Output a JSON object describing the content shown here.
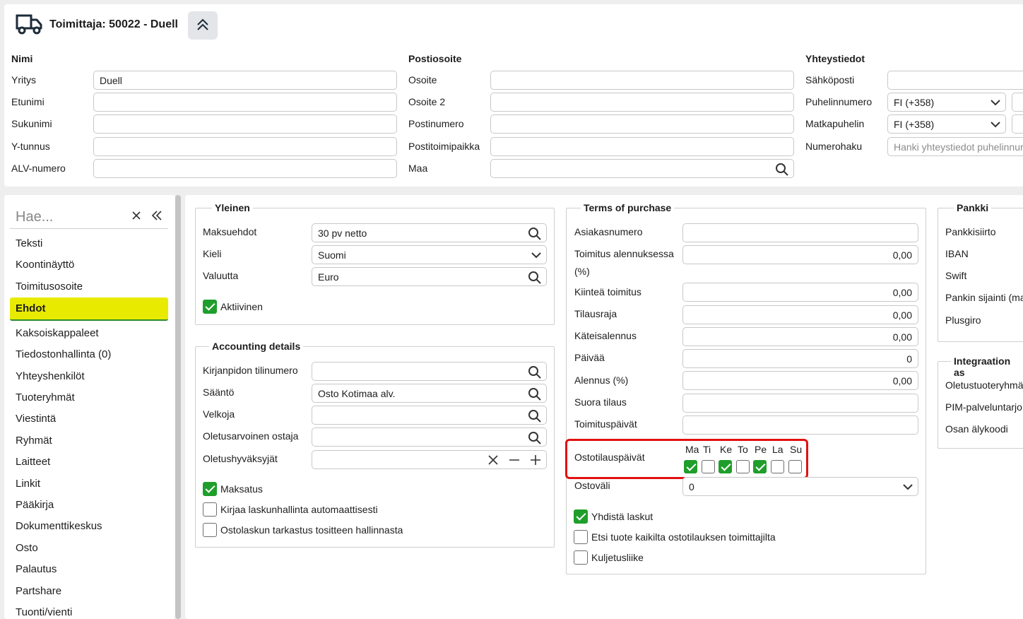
{
  "header": {
    "title": "Toimittaja: 50022 - Duell",
    "name_section": {
      "heading": "Nimi",
      "rows": [
        {
          "label": "Yritys",
          "value": "Duell"
        },
        {
          "label": "Etunimi",
          "value": ""
        },
        {
          "label": "Sukunimi",
          "value": ""
        },
        {
          "label": "Y-tunnus",
          "value": ""
        },
        {
          "label": "ALV-numero",
          "value": ""
        }
      ]
    },
    "address_section": {
      "heading": "Postiosoite",
      "rows": [
        {
          "label": "Osoite",
          "value": ""
        },
        {
          "label": "Osoite 2",
          "value": ""
        },
        {
          "label": "Postinumero",
          "value": ""
        },
        {
          "label": "Postitoimipaikka",
          "value": ""
        },
        {
          "label": "Maa",
          "value": ""
        }
      ]
    },
    "contact_section": {
      "heading": "Yhteystiedot",
      "rows": [
        {
          "label": "Sähköposti",
          "value": ""
        },
        {
          "label": "Puhelinnumero",
          "value": "FI (+358)"
        },
        {
          "label": "Matkapuhelin",
          "value": "FI (+358)"
        },
        {
          "label": "Numerohaku",
          "placeholder": "Hanki yhteystiedot puhelinnur"
        }
      ]
    }
  },
  "nav": {
    "search_placeholder": "Hae...",
    "items": [
      "Teksti",
      "Koontinäyttö",
      "Toimitusosoite",
      "Ehdot",
      "Kaksoiskappaleet",
      "Tiedostonhallinta (0)",
      "Yhteyshenkilöt",
      "Tuoteryhmät",
      "Viestintä",
      "Ryhmät",
      "Laitteet",
      "Linkit",
      "Pääkirja",
      "Dokumenttikeskus",
      "Osto",
      "Palautus",
      "Partshare",
      "Tuonti/vienti"
    ],
    "active_index": 3
  },
  "general": {
    "title": "Yleinen",
    "payment_terms_label": "Maksuehdot",
    "payment_terms_value": "30 pv netto",
    "language_label": "Kieli",
    "language_value": "Suomi",
    "currency_label": "Valuutta",
    "currency_value": "Euro",
    "active_label": "Aktiivinen",
    "active_checked": true
  },
  "accounting": {
    "title": "Accounting details",
    "account_label": "Kirjanpidon tilinumero",
    "account_value": "",
    "rule_label": "Sääntö",
    "rule_value": "Osto Kotimaa alv.",
    "creditor_label": "Velkoja",
    "creditor_value": "",
    "buyer_label": "Oletusarvoinen ostaja",
    "buyer_value": "",
    "approvers_label": "Oletushyväksyjät",
    "approvers_value": "",
    "checkboxes": [
      {
        "label": "Maksatus",
        "checked": true
      },
      {
        "label": "Kirjaa laskunhallinta automaattisesti",
        "checked": false
      },
      {
        "label": "Ostolaskun tarkastus tositteen hallinnasta",
        "checked": false
      }
    ]
  },
  "terms": {
    "title": "Terms of purchase",
    "customer_number_label": "Asiakasnumero",
    "customer_number_value": "",
    "discount_label_1": "Toimitus alennuksessa",
    "discount_label_2": "(%)",
    "discount_value": "0,00",
    "fixed_delivery_label": "Kiinteä toimitus",
    "fixed_delivery_value": "0,00",
    "order_limit_label": "Tilausraja",
    "order_limit_value": "0,00",
    "cash_discount_label": "Käteisalennus",
    "cash_discount_value": "0,00",
    "days_label": "Päivää",
    "days_value": "0",
    "discount_pct_label": "Alennus (%)",
    "discount_pct_value": "0,00",
    "direct_order_label": "Suora tilaus",
    "direct_order_value": "",
    "delivery_days_label": "Toimituspäivät",
    "delivery_days_value": "",
    "order_days_label": "Ostotilauspäivät",
    "weekdays": [
      {
        "label": "Ma",
        "checked": true
      },
      {
        "label": "Ti",
        "checked": false
      },
      {
        "label": "Ke",
        "checked": true
      },
      {
        "label": "To",
        "checked": false
      },
      {
        "label": "Pe",
        "checked": true
      },
      {
        "label": "La",
        "checked": false
      },
      {
        "label": "Su",
        "checked": false
      }
    ],
    "interval_label": "Ostoväli",
    "interval_value": "0",
    "checkboxes": [
      {
        "label": "Yhdistä laskut",
        "checked": true
      },
      {
        "label": "Etsi tuote kaikilta ostotilauksen toimittajilta",
        "checked": false
      },
      {
        "label": "Kuljetusliike",
        "checked": false
      }
    ]
  },
  "bank": {
    "title": "Pankki",
    "labels": [
      "Pankkisiirto",
      "IBAN",
      "Swift",
      "Pankin sijainti (ma",
      "Plusgiro"
    ]
  },
  "integration": {
    "title": "Integraation as",
    "labels": [
      "Oletustuoteryhmä",
      "PIM-palveluntarjo",
      "Osan älykoodi"
    ]
  },
  "colors": {
    "highlight": "#e8eb00",
    "check_green": "#1f9e2b",
    "red_box": "#e21111"
  }
}
